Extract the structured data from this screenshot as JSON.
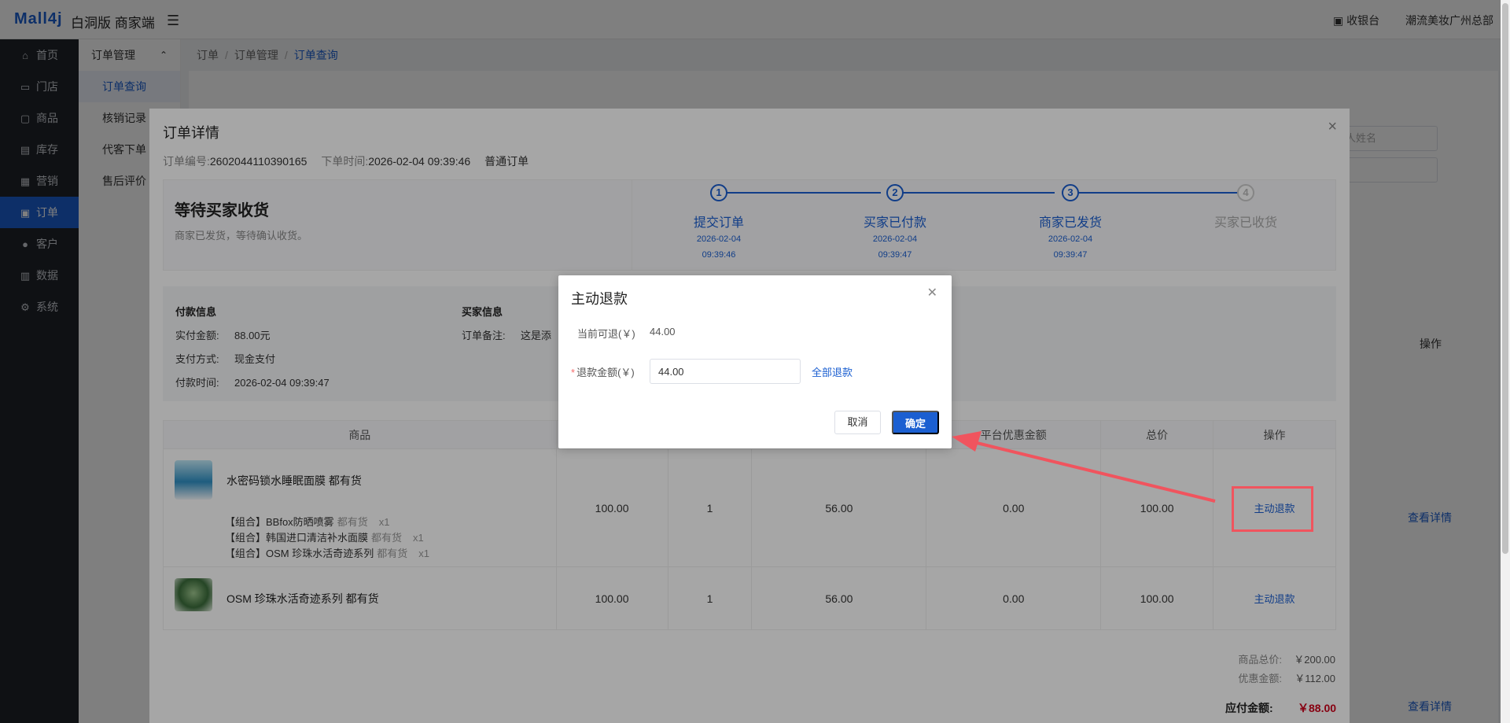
{
  "header": {
    "logo": "Mall4j",
    "edition": "白洞版 商家端",
    "cashier": "收银台",
    "store": "潮流美妆广州总部"
  },
  "sidebar": {
    "items": [
      {
        "label": "首页",
        "icon": "home-icon"
      },
      {
        "label": "门店",
        "icon": "store-icon"
      },
      {
        "label": "商品",
        "icon": "goods-icon"
      },
      {
        "label": "库存",
        "icon": "inventory-icon"
      },
      {
        "label": "营销",
        "icon": "marketing-icon"
      },
      {
        "label": "订单",
        "icon": "order-icon"
      },
      {
        "label": "客户",
        "icon": "customer-icon"
      },
      {
        "label": "数据",
        "icon": "data-icon"
      },
      {
        "label": "系统",
        "icon": "system-icon"
      }
    ],
    "active_index": 5
  },
  "sub_sidebar": {
    "group": "订单管理",
    "items": [
      "订单查询",
      "核销记录",
      "代客下单",
      "售后评价"
    ]
  },
  "breadcrumb": [
    "订单",
    "订单管理",
    "订单查询"
  ],
  "background": {
    "search_placeholder": "人姓名",
    "op_header": "操作",
    "link1": "查看详情",
    "link2": "查看详情"
  },
  "detail": {
    "title": "订单详情",
    "order_no_label": "订单编号:",
    "order_no": "2602044110390165",
    "order_time_label": "下单时间:",
    "order_time": "2026-02-04 09:39:46",
    "order_type": "普通订单",
    "status_title": "等待买家收货",
    "status_desc": "商家已发货，等待确认收货。",
    "steps": [
      {
        "num": "1",
        "name": "提交订单",
        "date": "2026-02-04",
        "time": "09:39:46",
        "done": true
      },
      {
        "num": "2",
        "name": "买家已付款",
        "date": "2026-02-04",
        "time": "09:39:47",
        "done": true
      },
      {
        "num": "3",
        "name": "商家已发货",
        "date": "2026-02-04",
        "time": "09:39:47",
        "done": true
      },
      {
        "num": "4",
        "name": "买家已收货",
        "date": "",
        "time": "",
        "done": false
      }
    ],
    "pay_info": {
      "heading": "付款信息",
      "paid_label": "实付金额:",
      "paid": "88.00元",
      "method_label": "支付方式:",
      "method": "现金支付",
      "time_label": "付款时间:",
      "time": "2026-02-04 09:39:47"
    },
    "buyer_info": {
      "heading": "买家信息",
      "remark_label": "订单备注:",
      "remark": "这是添"
    },
    "table": {
      "headers": [
        "商品",
        "",
        "",
        "",
        "平台优惠金额",
        "总价",
        "操作"
      ],
      "rows": [
        {
          "name": "水密码锁水睡眠面膜 都有货",
          "combos": [
            {
              "name": "【组合】BBfox防晒喷雾",
              "stock": "都有货",
              "qty": "x1"
            },
            {
              "name": "【组合】韩国进口清洁补水面膜",
              "stock": "都有货",
              "qty": "x1"
            },
            {
              "name": "【组合】OSM 珍珠水活奇迹系列",
              "stock": "都有货",
              "qty": "x1"
            }
          ],
          "price": "100.00",
          "count": "1",
          "discount": "56.00",
          "platform": "0.00",
          "total": "100.00",
          "action": "主动退款"
        },
        {
          "name": "OSM 珍珠水活奇迹系列 都有货",
          "combos": [],
          "price": "100.00",
          "count": "1",
          "discount": "56.00",
          "platform": "0.00",
          "total": "100.00",
          "action": "主动退款"
        }
      ]
    },
    "summary": {
      "goods_total_label": "商品总价:",
      "goods_total": "￥200.00",
      "discount_label": "优惠金额:",
      "discount": "￥112.00",
      "payable_label": "应付金额:",
      "payable": "￥88.00"
    }
  },
  "refund": {
    "title": "主动退款",
    "available_label": "当前可退(￥)",
    "available": "44.00",
    "amount_label": "退款金额(￥)",
    "amount_value": "44.00",
    "refund_all": "全部退款",
    "cancel": "取消",
    "confirm": "确定"
  },
  "colors": {
    "accent": "#1b5fd1",
    "highlight": "#f0545e",
    "price_red": "#d0021b"
  }
}
